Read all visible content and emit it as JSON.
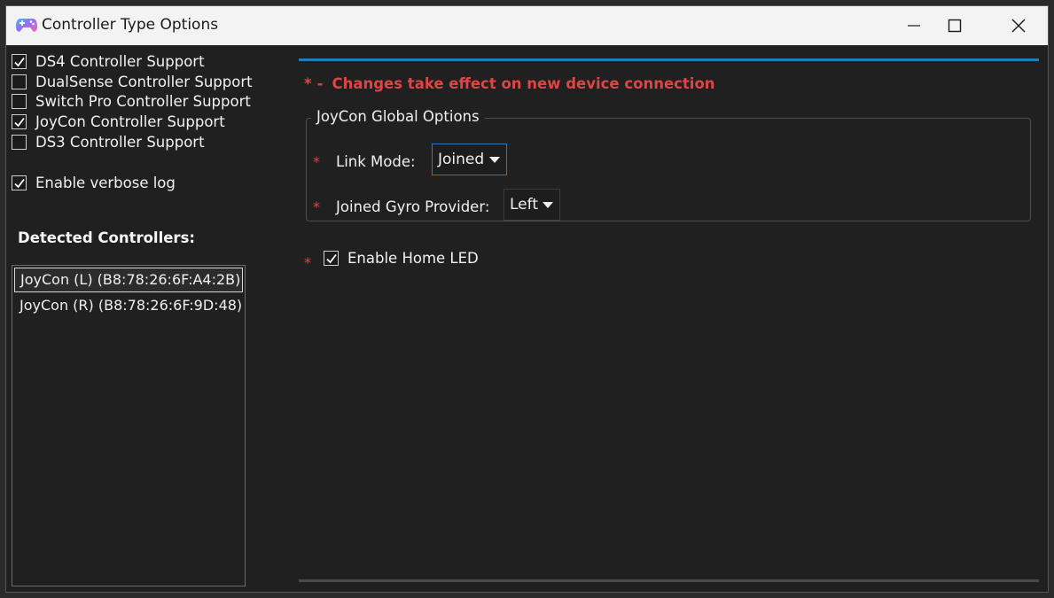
{
  "window": {
    "title": "Controller Type Options",
    "icon": "gamepad-icon"
  },
  "titlebar_buttons": {
    "minimize": "minimize-icon",
    "maximize": "maximize-icon",
    "close": "close-icon"
  },
  "options": [
    {
      "label": "DS4 Controller Support",
      "checked": true
    },
    {
      "label": "DualSense Controller Support",
      "checked": false
    },
    {
      "label": "Switch Pro Controller Support",
      "checked": false
    },
    {
      "label": "JoyCon Controller Support",
      "checked": true
    },
    {
      "label": "DS3 Controller Support",
      "checked": false
    }
  ],
  "verbose_log": {
    "label": "Enable verbose log",
    "checked": true
  },
  "detected": {
    "label": "Detected Controllers:",
    "items": [
      {
        "label": "JoyCon (L) (B8:78:26:6F:A4:2B)",
        "selected": true
      },
      {
        "label": "JoyCon (R) (B8:78:26:6F:9D:48)",
        "selected": false
      }
    ]
  },
  "notice": {
    "star": "*",
    "dash": "-",
    "text": "Changes take effect on new device connection"
  },
  "joycon_group": {
    "title": "JoyCon Global Options",
    "link_mode": {
      "star": "*",
      "label": "Link Mode:",
      "value": "Joined"
    },
    "gyro_provider": {
      "star": "*",
      "label": "Joined Gyro Provider:",
      "value": "Left"
    }
  },
  "home_led": {
    "star": "*",
    "label": "Enable Home LED",
    "checked": true
  },
  "colors": {
    "accent": "#1b7fc4",
    "warning": "#e04444",
    "background": "#202020"
  }
}
